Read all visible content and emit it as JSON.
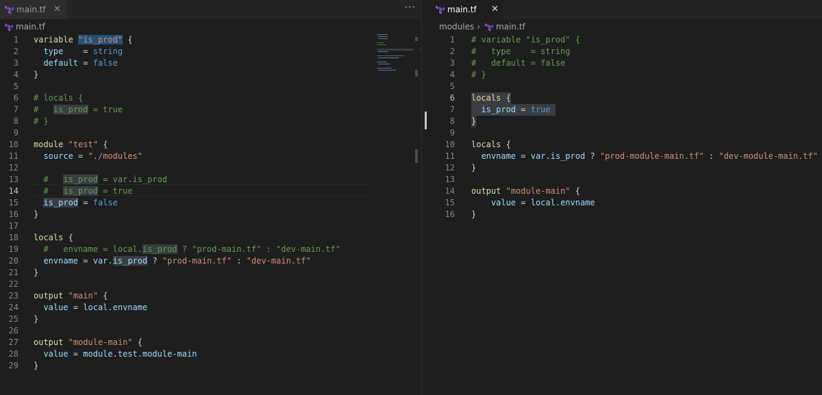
{
  "left": {
    "tab": {
      "title": "main.tf",
      "close": "✕"
    },
    "more": "···",
    "breadcrumb": {
      "file": "main.tf"
    },
    "lines": [
      {
        "n": "1"
      },
      {
        "n": "2"
      },
      {
        "n": "3"
      },
      {
        "n": "4"
      },
      {
        "n": "5"
      },
      {
        "n": "6"
      },
      {
        "n": "7"
      },
      {
        "n": "8"
      },
      {
        "n": "9"
      },
      {
        "n": "10"
      },
      {
        "n": "11"
      },
      {
        "n": "12"
      },
      {
        "n": "13"
      },
      {
        "n": "14"
      },
      {
        "n": "15"
      },
      {
        "n": "16"
      },
      {
        "n": "17"
      },
      {
        "n": "18"
      },
      {
        "n": "19"
      },
      {
        "n": "20"
      },
      {
        "n": "21"
      },
      {
        "n": "22"
      },
      {
        "n": "23"
      },
      {
        "n": "24"
      },
      {
        "n": "25"
      },
      {
        "n": "26"
      },
      {
        "n": "27"
      },
      {
        "n": "28"
      },
      {
        "n": "29"
      }
    ],
    "code": {
      "l1": {
        "kw": "variable",
        "name": "\"is_prod\"",
        "br": "{"
      },
      "l2": {
        "key": "type",
        "eq": "=",
        "val": "string"
      },
      "l3": {
        "key": "default",
        "eq": "=",
        "val": "false"
      },
      "l4": "}",
      "l6": "# locals {",
      "l7": {
        "c1": "#",
        "c2": "is_prod",
        "c3": "= true"
      },
      "l8": "# }",
      "l10": {
        "kw": "module",
        "name": "\"test\"",
        "br": "{"
      },
      "l11": {
        "key": "source",
        "eq": "=",
        "val": "\"./modules\""
      },
      "l13": {
        "c1": "#",
        "c2": "is_prod",
        "c3": "= var.is_prod"
      },
      "l14": {
        "c1": "#",
        "c2": "is_prod",
        "c3": "= true"
      },
      "l15": {
        "key": "is_prod",
        "eq": "=",
        "val": "false"
      },
      "l16": "}",
      "l18": {
        "kw": "locals",
        "br": "{"
      },
      "l19": {
        "c1": "#",
        "c2": "envname",
        "c3": "= local.",
        "c4": "is_prod",
        "c5": " ? \"prod-main.tf\" : \"dev-main.tf\""
      },
      "l20": {
        "key": "envname",
        "eq": "=",
        "ref": "var.",
        "ref2": "is_prod",
        "q": "?",
        "s1": "\"prod-main.tf\"",
        "colon": ":",
        "s2": "\"dev-main.tf\""
      },
      "l21": "}",
      "l23": {
        "kw": "output",
        "name": "\"main\"",
        "br": "{"
      },
      "l24": {
        "key": "value",
        "eq": "=",
        "val": "local.envname"
      },
      "l25": "}",
      "l27": {
        "kw": "output",
        "name": "\"module-main\"",
        "br": "{"
      },
      "l28": {
        "key": "value",
        "eq": "=",
        "val": "module.test.module-main"
      },
      "l29": "}"
    }
  },
  "right": {
    "tab": {
      "title": "main.tf",
      "close": "✕"
    },
    "breadcrumb": {
      "folder": "modules",
      "sep": "›",
      "file": "main.tf"
    },
    "lines": [
      {
        "n": "1"
      },
      {
        "n": "2"
      },
      {
        "n": "3"
      },
      {
        "n": "4"
      },
      {
        "n": "5"
      },
      {
        "n": "6"
      },
      {
        "n": "7"
      },
      {
        "n": "8"
      },
      {
        "n": "9"
      },
      {
        "n": "10"
      },
      {
        "n": "11"
      },
      {
        "n": "12"
      },
      {
        "n": "13"
      },
      {
        "n": "14"
      },
      {
        "n": "15"
      },
      {
        "n": "16"
      }
    ],
    "code": {
      "l1": "# variable \"is_prod\" {",
      "l2": "#   type    = string",
      "l3": "#   default = false",
      "l4": "# }",
      "l6": {
        "kw": "locals",
        "br": "{"
      },
      "l7": {
        "key": "is_prod",
        "eq": "=",
        "val": "true"
      },
      "l8": "}",
      "l10": {
        "kw": "locals",
        "br": "{"
      },
      "l11": {
        "key": "envname",
        "eq": "=",
        "ref": "var.is_prod",
        "q": "?",
        "s1": "\"prod-module-main.tf\"",
        "colon": ":",
        "s2": "\"dev-module-main.tf\""
      },
      "l12": "}",
      "l14": {
        "kw": "output",
        "name": "\"module-main\"",
        "br": "{"
      },
      "l15": {
        "key": "value",
        "eq": "=",
        "val": "local.envname"
      },
      "l16": "}"
    }
  },
  "colors": {
    "background": "#1e1e1e",
    "keyword": "#9cdcfe",
    "string": "#ce9178",
    "bool": "#569cd6",
    "comment": "#6a9955",
    "terraform_icon": "#844fba"
  },
  "icons": {
    "file": "terraform-icon",
    "more": "more-actions-icon",
    "close": "close-icon"
  }
}
